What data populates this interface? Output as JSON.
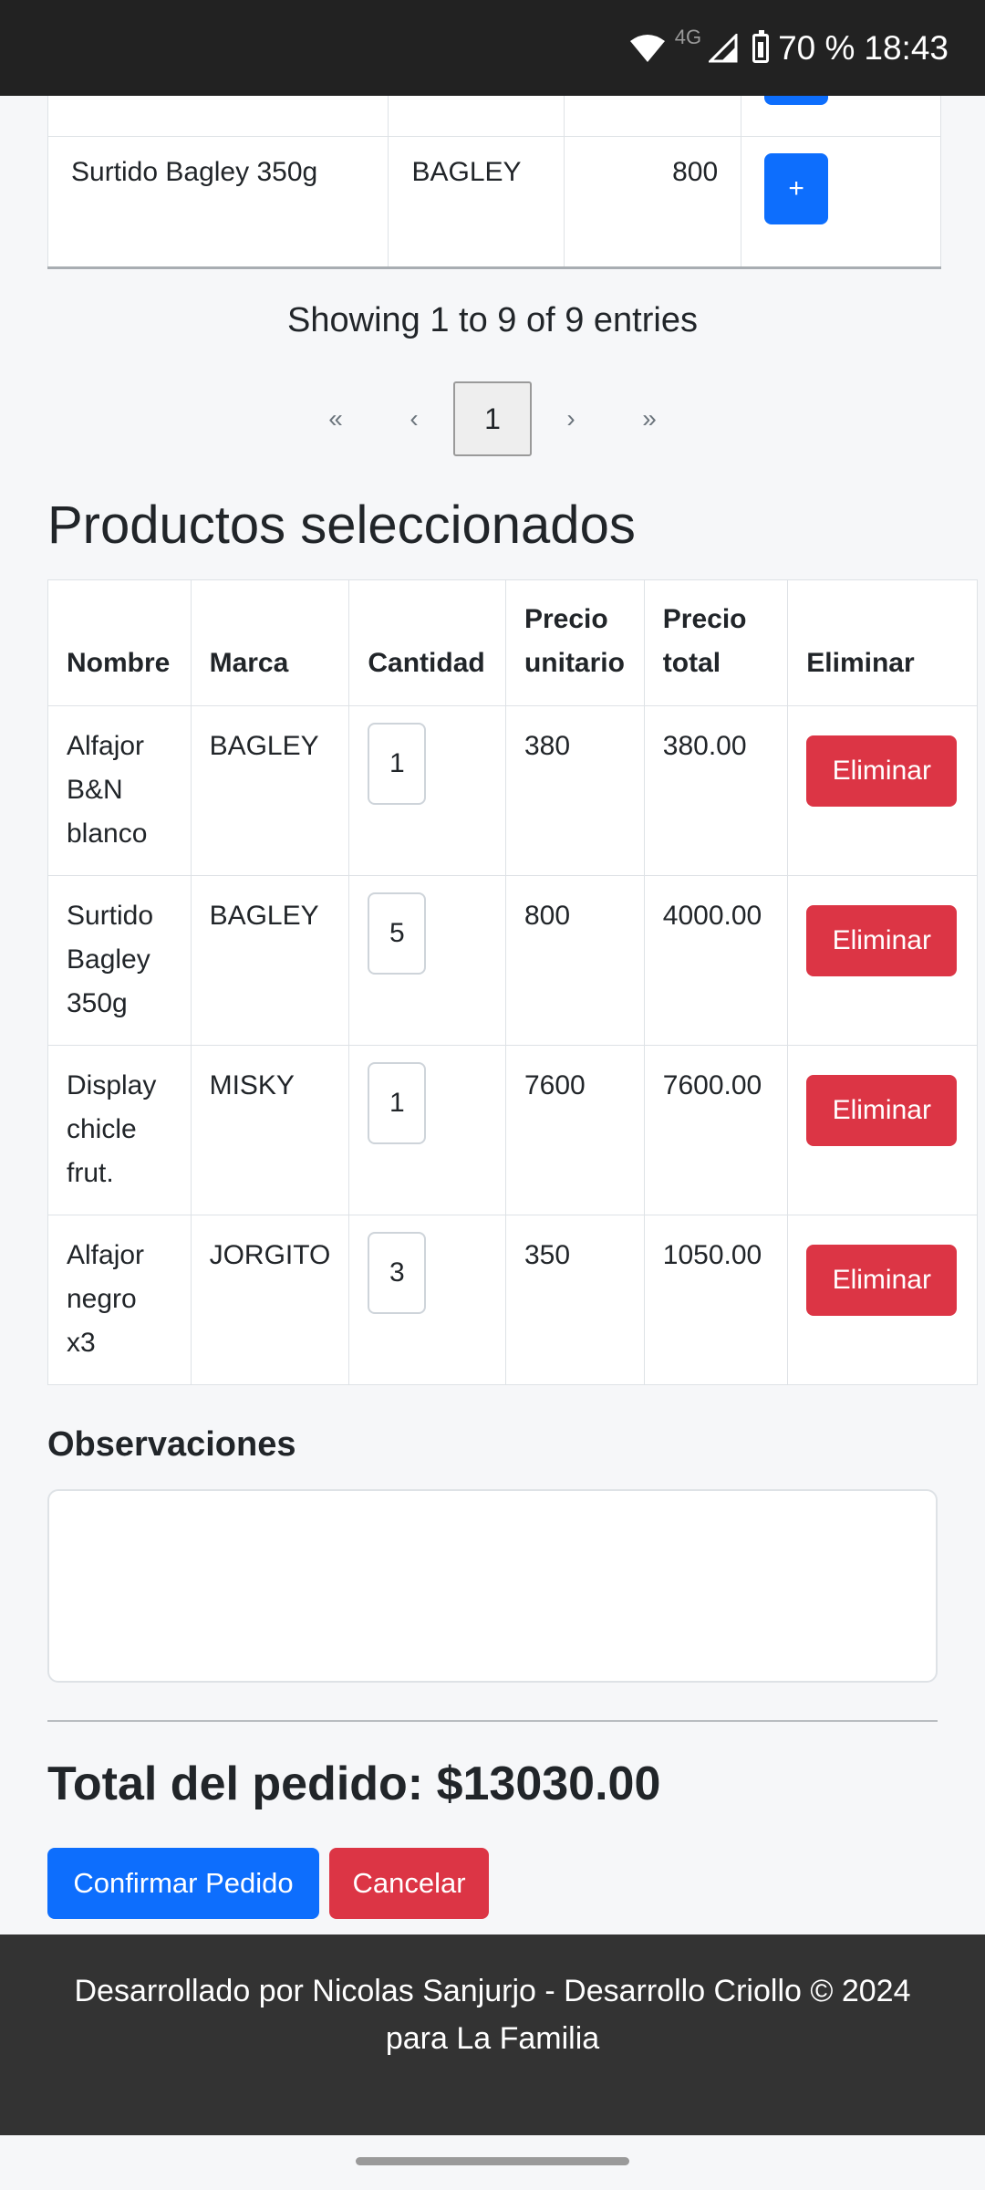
{
  "status_bar": {
    "network": "4G",
    "battery": "70 %",
    "time": "18:43",
    "icons": [
      "wifi-icon",
      "signal-icon",
      "battery-icon"
    ]
  },
  "products_table": {
    "rows": [
      {
        "nombre": "Surtido Bagley 350g",
        "marca": "BAGLEY",
        "precio": "800",
        "add_label": "+"
      }
    ]
  },
  "pagination": {
    "info": "Showing 1 to 9 of 9 entries",
    "first": "«",
    "prev": "‹",
    "current": "1",
    "next": "›",
    "last": "»"
  },
  "selected": {
    "title": "Productos seleccionados",
    "headers": [
      "Nombre",
      "Marca",
      "Cantidad",
      "Precio unitario",
      "Precio total",
      "Eliminar"
    ],
    "rows": [
      {
        "nombre": "Alfajor B&N blanco",
        "marca": "BAGLEY",
        "cantidad": "1",
        "precio_unitario": "380",
        "precio_total": "380.00",
        "accion": "Eliminar"
      },
      {
        "nombre": "Surtido Bagley 350g",
        "marca": "BAGLEY",
        "cantidad": "5",
        "precio_unitario": "800",
        "precio_total": "4000.00",
        "accion": "Eliminar"
      },
      {
        "nombre": "Display chicle frut.",
        "marca": "MISKY",
        "cantidad": "1",
        "precio_unitario": "7600",
        "precio_total": "7600.00",
        "accion": "Eliminar"
      },
      {
        "nombre": "Alfajor negro x3",
        "marca": "JORGITO",
        "cantidad": "3",
        "precio_unitario": "350",
        "precio_total": "1050.00",
        "accion": "Eliminar"
      }
    ]
  },
  "observaciones": {
    "label": "Observaciones",
    "value": ""
  },
  "order": {
    "total_label": "Total del pedido: $13030.00",
    "confirm_label": "Confirmar Pedido",
    "cancel_label": "Cancelar"
  },
  "footer": {
    "line1": "Desarrollado por Nicolas Sanjurjo - Desarrollo Criollo © 2024",
    "line2": "para La Familia"
  },
  "colors": {
    "primary": "#0d6efd",
    "danger": "#dc3545",
    "footer_bg": "#333333",
    "status_bar_bg": "#222222"
  }
}
